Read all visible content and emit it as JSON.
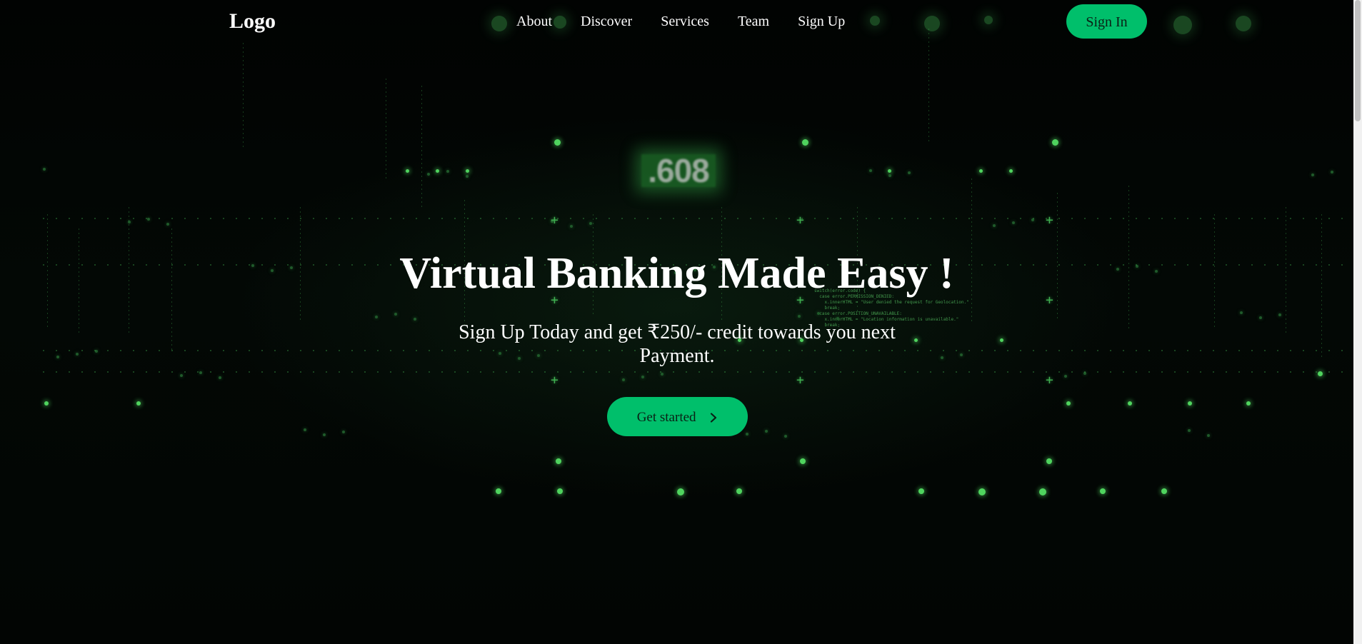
{
  "navbar": {
    "logo": "Logo",
    "links": [
      "About",
      "Discover",
      "Services",
      "Team",
      "Sign Up"
    ],
    "signin_label": "Sign In"
  },
  "hero": {
    "title": "Virtual Banking Made Easy !",
    "subtitle": "Sign Up Today and get ₹250/- credit towards you next Payment.",
    "cta_label": "Get started",
    "cta_icon": "chevron-right-icon"
  },
  "background": {
    "glow_number": ".608",
    "code_snippet": "switch(error.code) {\n  case error.PERMISSION_DENIED:\n    x.innerHTML = \"User denied the request for Geolocation.\"\n    break;\n  case error.POSITION_UNAVAILABLE:\n    x.innerHTML = \"Location information is unavailable.\"\n    break;"
  },
  "colors": {
    "accent": "#00bf6b",
    "background": "#020503",
    "matrix_green": "#4fd35e"
  }
}
